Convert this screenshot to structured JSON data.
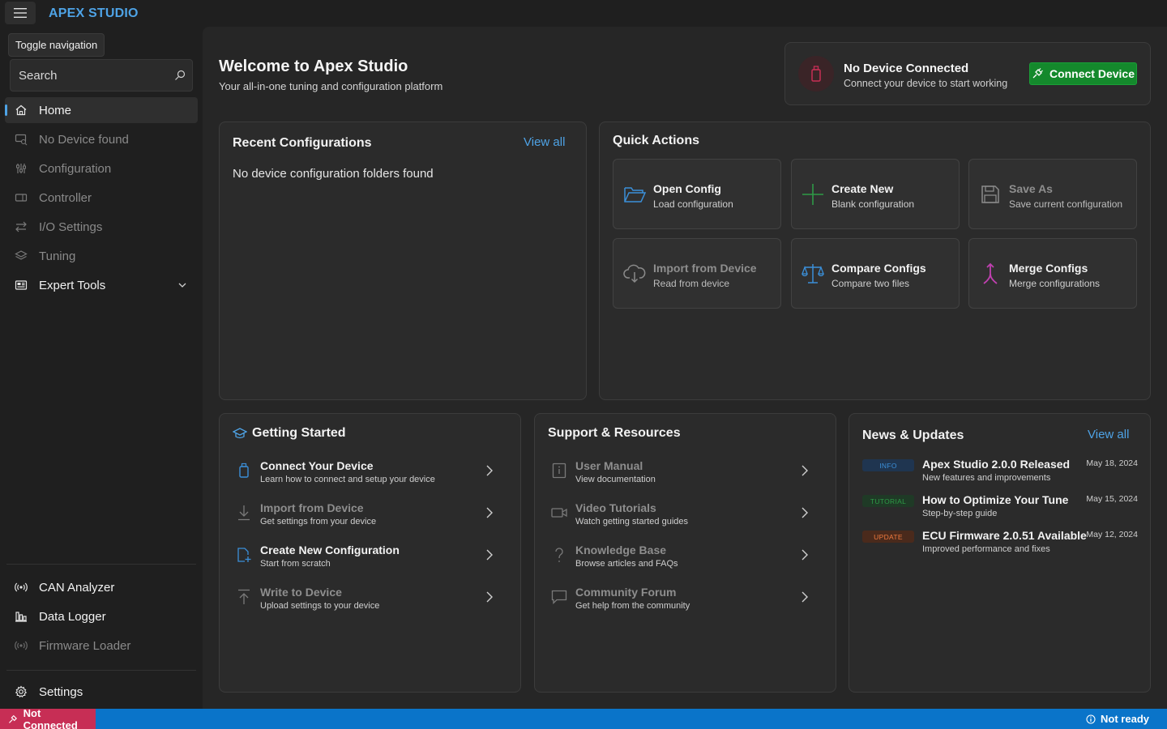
{
  "app": {
    "title": "APEX STUDIO"
  },
  "sidebar": {
    "tooltip": "Toggle navigation",
    "search": {
      "placeholder": "Search",
      "value": ""
    },
    "items": [
      {
        "label": "Home",
        "icon": "home-icon",
        "active": true,
        "disabled": false
      },
      {
        "label": "No Device found",
        "icon": "device-search-icon",
        "disabled": true
      },
      {
        "label": "Configuration",
        "icon": "sliders-icon",
        "disabled": true
      },
      {
        "label": "Controller",
        "icon": "controller-icon",
        "disabled": true
      },
      {
        "label": "I/O Settings",
        "icon": "arrows-swap-icon",
        "disabled": true
      },
      {
        "label": "Tuning",
        "icon": "layers-icon",
        "disabled": true
      },
      {
        "label": "Expert Tools",
        "icon": "toolbox-icon",
        "disabled": false,
        "expandable": true
      }
    ],
    "bottom_items": [
      {
        "label": "CAN Analyzer",
        "icon": "broadcast-icon",
        "disabled": false
      },
      {
        "label": "Data Logger",
        "icon": "bar-chart-icon",
        "disabled": false
      },
      {
        "label": "Firmware Loader",
        "icon": "broadcast-icon",
        "disabled": true
      }
    ],
    "settings": {
      "label": "Settings",
      "icon": "gear-icon"
    }
  },
  "welcome": {
    "title": "Welcome to Apex Studio",
    "subtitle": "Your all-in-one tuning and configuration platform"
  },
  "device_status": {
    "title": "No Device Connected",
    "subtitle": "Connect your device to start working",
    "button": "Connect Device",
    "icon": "usb-drive-icon",
    "accent": "#c72e55",
    "button_color": "#14892c"
  },
  "recent": {
    "title": "Recent Configurations",
    "view_all": "View all",
    "empty": "No device configuration folders found"
  },
  "quick_actions": {
    "title": "Quick Actions",
    "items": [
      {
        "title": "Open Config",
        "subtitle": "Load configuration",
        "icon": "folder-open-icon",
        "disabled": false
      },
      {
        "title": "Create New",
        "subtitle": "Blank configuration",
        "icon": "plus-icon",
        "disabled": false
      },
      {
        "title": "Save As",
        "subtitle": "Save current configuration",
        "icon": "save-icon",
        "disabled": true
      },
      {
        "title": "Import from Device",
        "subtitle": "Read from device",
        "icon": "cloud-download-icon",
        "disabled": true
      },
      {
        "title": "Compare Configs",
        "subtitle": "Compare two files",
        "icon": "scale-icon",
        "disabled": false
      },
      {
        "title": "Merge Configs",
        "subtitle": "Merge configurations",
        "icon": "merge-icon",
        "disabled": false
      }
    ]
  },
  "getting_started": {
    "title": "Getting Started",
    "icon": "graduation-cap-icon",
    "items": [
      {
        "title": "Connect Your Device",
        "subtitle": "Learn how to connect and setup your device",
        "icon": "usb-drive-icon",
        "disabled": false
      },
      {
        "title": "Import from Device",
        "subtitle": "Get settings from your device",
        "icon": "download-icon",
        "disabled": true
      },
      {
        "title": "Create New Configuration",
        "subtitle": "Start from scratch",
        "icon": "document-add-icon",
        "disabled": false
      },
      {
        "title": "Write to Device",
        "subtitle": "Upload settings to your device",
        "icon": "upload-icon",
        "disabled": true
      }
    ]
  },
  "support": {
    "title": "Support & Resources",
    "items": [
      {
        "title": "User Manual",
        "subtitle": "View documentation",
        "icon": "manual-icon",
        "disabled": true
      },
      {
        "title": "Video Tutorials",
        "subtitle": "Watch getting started guides",
        "icon": "video-icon",
        "disabled": true
      },
      {
        "title": "Knowledge Base",
        "subtitle": "Browse articles and FAQs",
        "icon": "question-icon",
        "disabled": true
      },
      {
        "title": "Community Forum",
        "subtitle": "Get help from the community",
        "icon": "chat-icon",
        "disabled": true
      }
    ]
  },
  "news": {
    "title": "News & Updates",
    "view_all": "View all",
    "items": [
      {
        "badge": "INFO",
        "badge_color": "#2f6fb3",
        "title": "Apex Studio 2.0.0 Released",
        "subtitle": "New features and improvements",
        "date": "May 18, 2024"
      },
      {
        "badge": "TUTORIAL",
        "badge_color": "#2d8a3e",
        "title": "How to Optimize Your Tune",
        "subtitle": "Step-by-step guide",
        "date": "May 15, 2024"
      },
      {
        "badge": "UPDATE",
        "badge_color": "#e0662e",
        "title": "ECU Firmware 2.0.51 Available",
        "subtitle": "Improved performance and fixes",
        "date": "May 12, 2024"
      }
    ]
  },
  "statusbar": {
    "left": "Not Connected",
    "right": "Not ready",
    "left_color": "#c72e55",
    "bar_color": "#0a74c9"
  }
}
